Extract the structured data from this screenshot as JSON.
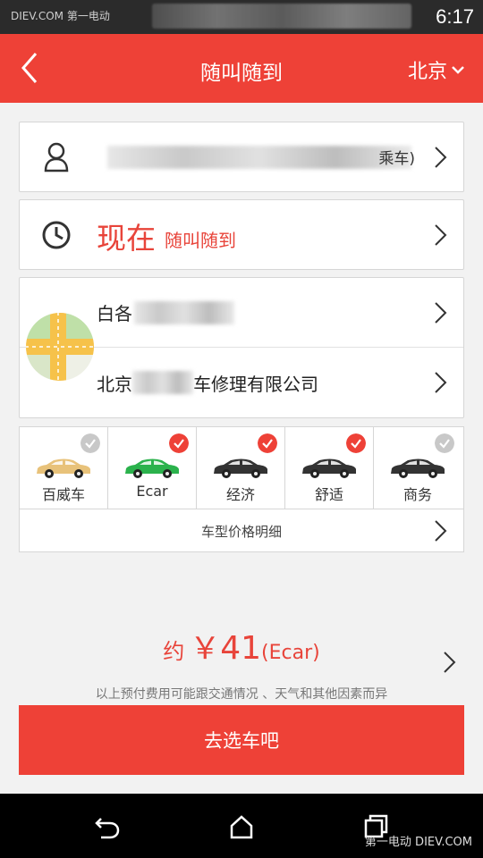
{
  "status_bar": {
    "watermark": "DIEV.COM 第一电动",
    "time": "6:17"
  },
  "header": {
    "back_icon": "chevron-left-icon",
    "title": "随叫随到",
    "city": "北京",
    "city_icon": "chevron-down-icon",
    "color": "#ee4137"
  },
  "passenger": {
    "icon": "person-icon",
    "label_suffix": "乘车)"
  },
  "time_select": {
    "icon": "clock-icon",
    "value": "现在",
    "subtitle": "随叫随到"
  },
  "route": {
    "map_icon": "map-thumbnail-icon",
    "start_prefix": "白各",
    "end_prefix": "北京",
    "end_suffix": "车修理有限公司"
  },
  "car_types": [
    {
      "label": "百威车",
      "checked": false,
      "car_color": "#e8c27a"
    },
    {
      "label": "Ecar",
      "checked": true,
      "car_color": "#2bb24c"
    },
    {
      "label": "经济",
      "checked": true,
      "car_color": "#333333"
    },
    {
      "label": "舒适",
      "checked": true,
      "car_color": "#333333"
    },
    {
      "label": "商务",
      "checked": false,
      "car_color": "#333333"
    }
  ],
  "price_detail": {
    "label": "车型价格明细"
  },
  "estimate": {
    "prefix": "约",
    "currency": "￥",
    "amount": "41",
    "car_type": "(Ecar)",
    "disclaimer": "以上预付费用可能跟交通情况 、天气和其他因素而异"
  },
  "cta": {
    "label": "去选车吧"
  },
  "nav": {
    "back_icon": "back-arrow-icon",
    "home_icon": "home-icon",
    "recents_icon": "recent-apps-icon",
    "watermark": "第一电动 DIEV.COM"
  }
}
